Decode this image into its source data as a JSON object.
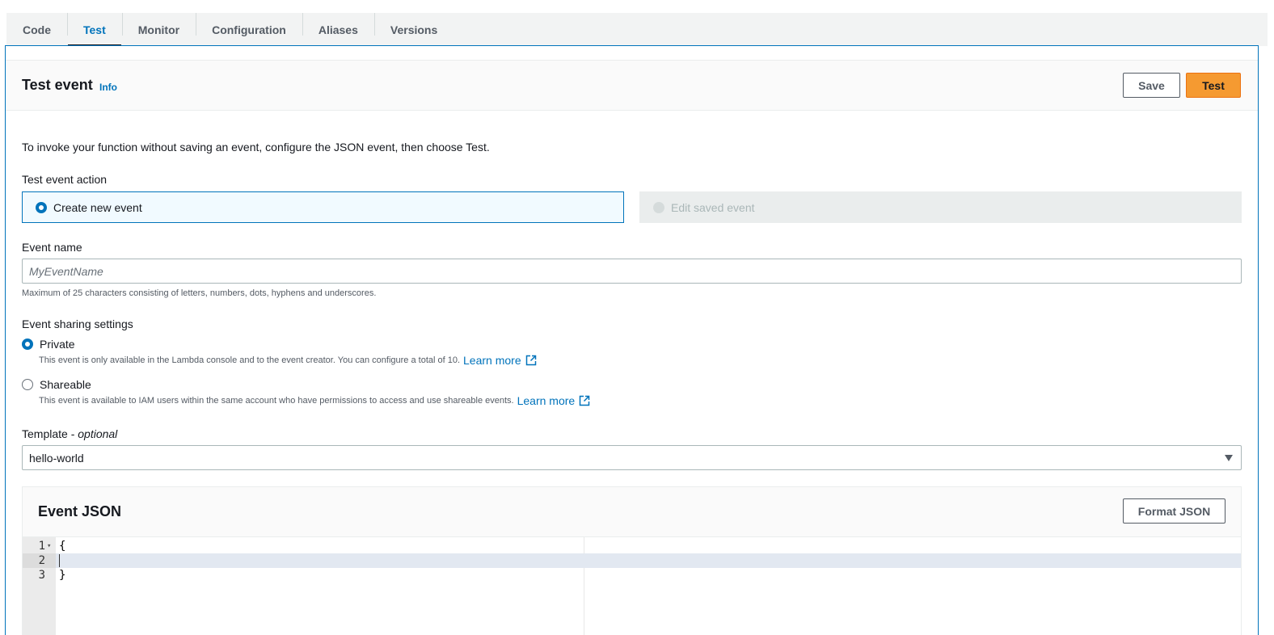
{
  "tabs": [
    {
      "label": "Code",
      "active": false
    },
    {
      "label": "Test",
      "active": true
    },
    {
      "label": "Monitor",
      "active": false
    },
    {
      "label": "Configuration",
      "active": false
    },
    {
      "label": "Aliases",
      "active": false
    },
    {
      "label": "Versions",
      "active": false
    }
  ],
  "header": {
    "title": "Test event",
    "info": "Info",
    "save_label": "Save",
    "test_label": "Test"
  },
  "description": "To invoke your function without saving an event, configure the JSON event, then choose Test.",
  "test_event_action": {
    "label": "Test event action",
    "options": [
      {
        "label": "Create new event",
        "selected": true,
        "disabled": false
      },
      {
        "label": "Edit saved event",
        "selected": false,
        "disabled": true
      }
    ]
  },
  "event_name": {
    "label": "Event name",
    "placeholder": "MyEventName",
    "value": "",
    "hint": "Maximum of 25 characters consisting of letters, numbers, dots, hyphens and underscores."
  },
  "sharing": {
    "label": "Event sharing settings",
    "private": {
      "label": "Private",
      "selected": true,
      "description": "This event is only available in the Lambda console and to the event creator. You can configure a total of 10.",
      "link": "Learn more"
    },
    "shareable": {
      "label": "Shareable",
      "selected": false,
      "description": "This event is available to IAM users within the same account who have permissions to access and use shareable events.",
      "link": "Learn more"
    }
  },
  "template": {
    "label": "Template - ",
    "label_optional": "optional",
    "value": "hello-world"
  },
  "event_json": {
    "title": "Event JSON",
    "format_label": "Format JSON",
    "lines": [
      {
        "num": "1",
        "code": "{"
      },
      {
        "num": "2",
        "code": ""
      },
      {
        "num": "3",
        "code": "}"
      }
    ]
  },
  "colors": {
    "accent": "#0073bb",
    "primary_button": "#f59a31",
    "selected_tile_bg": "#f1faff"
  }
}
